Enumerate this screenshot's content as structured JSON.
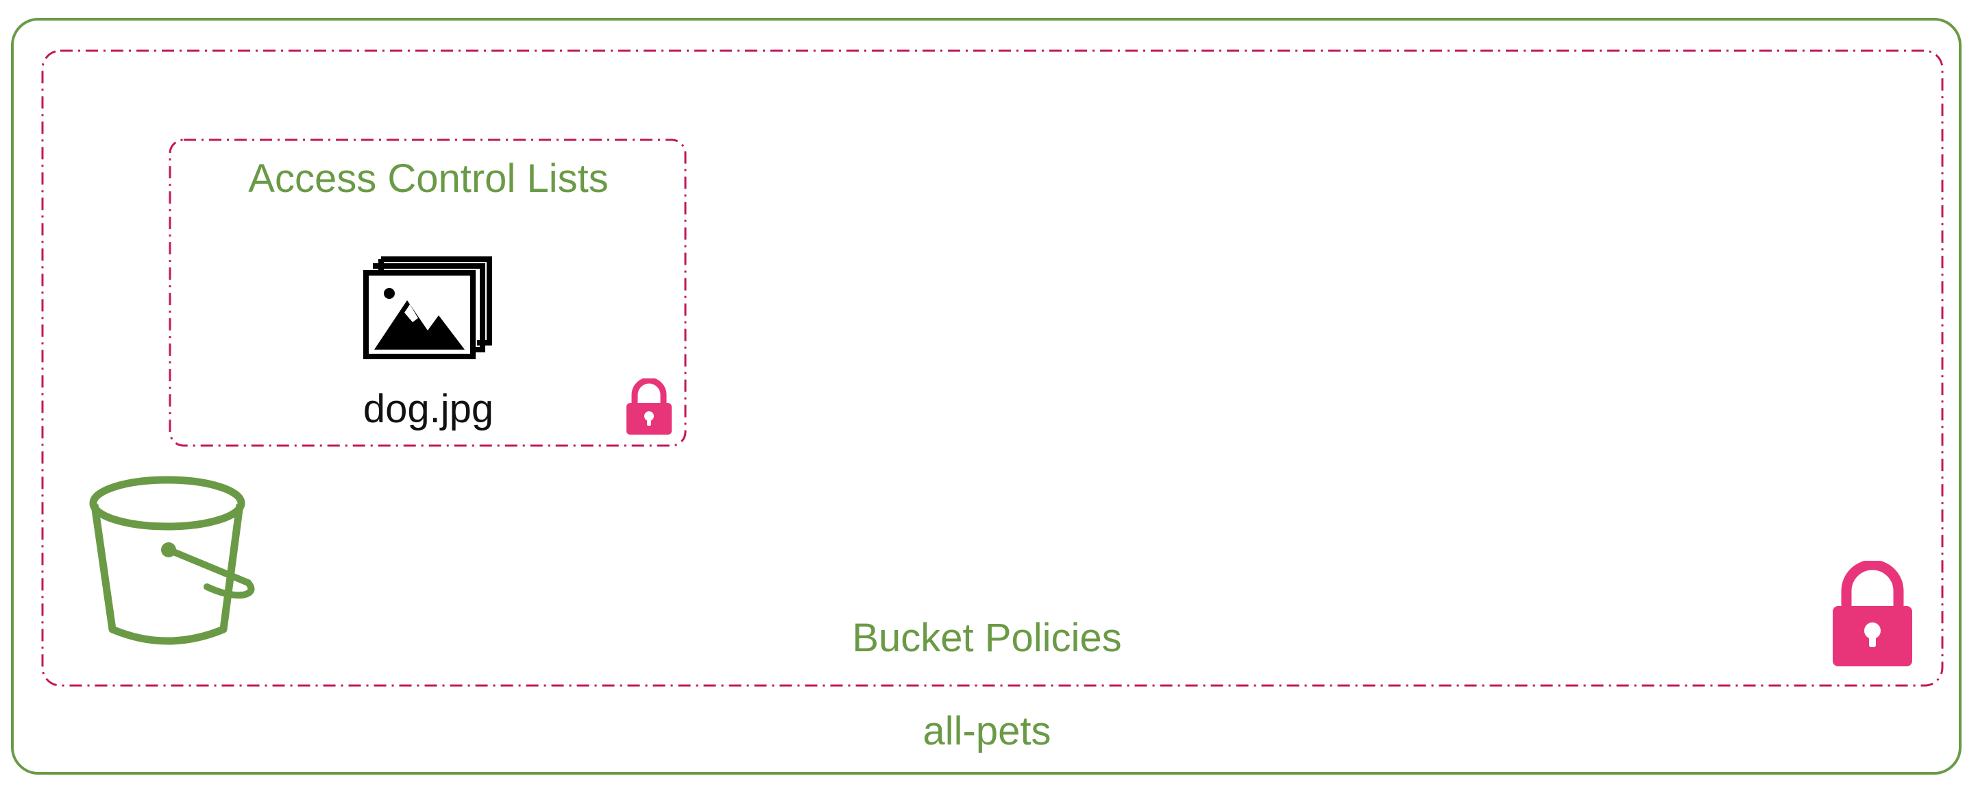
{
  "bucket": {
    "name": "all-pets",
    "icon": "bucket-icon",
    "color": "#6a9a46"
  },
  "bucket_policies": {
    "label": "Bucket Policies",
    "lock_icon": "lock-icon",
    "frame_color": "#c2185b",
    "lock_color": "#e8357a"
  },
  "access_control_lists": {
    "label": "Access Control Lists",
    "lock_icon": "lock-icon",
    "object": {
      "filename": "dog.jpg",
      "icon": "images-icon"
    }
  }
}
